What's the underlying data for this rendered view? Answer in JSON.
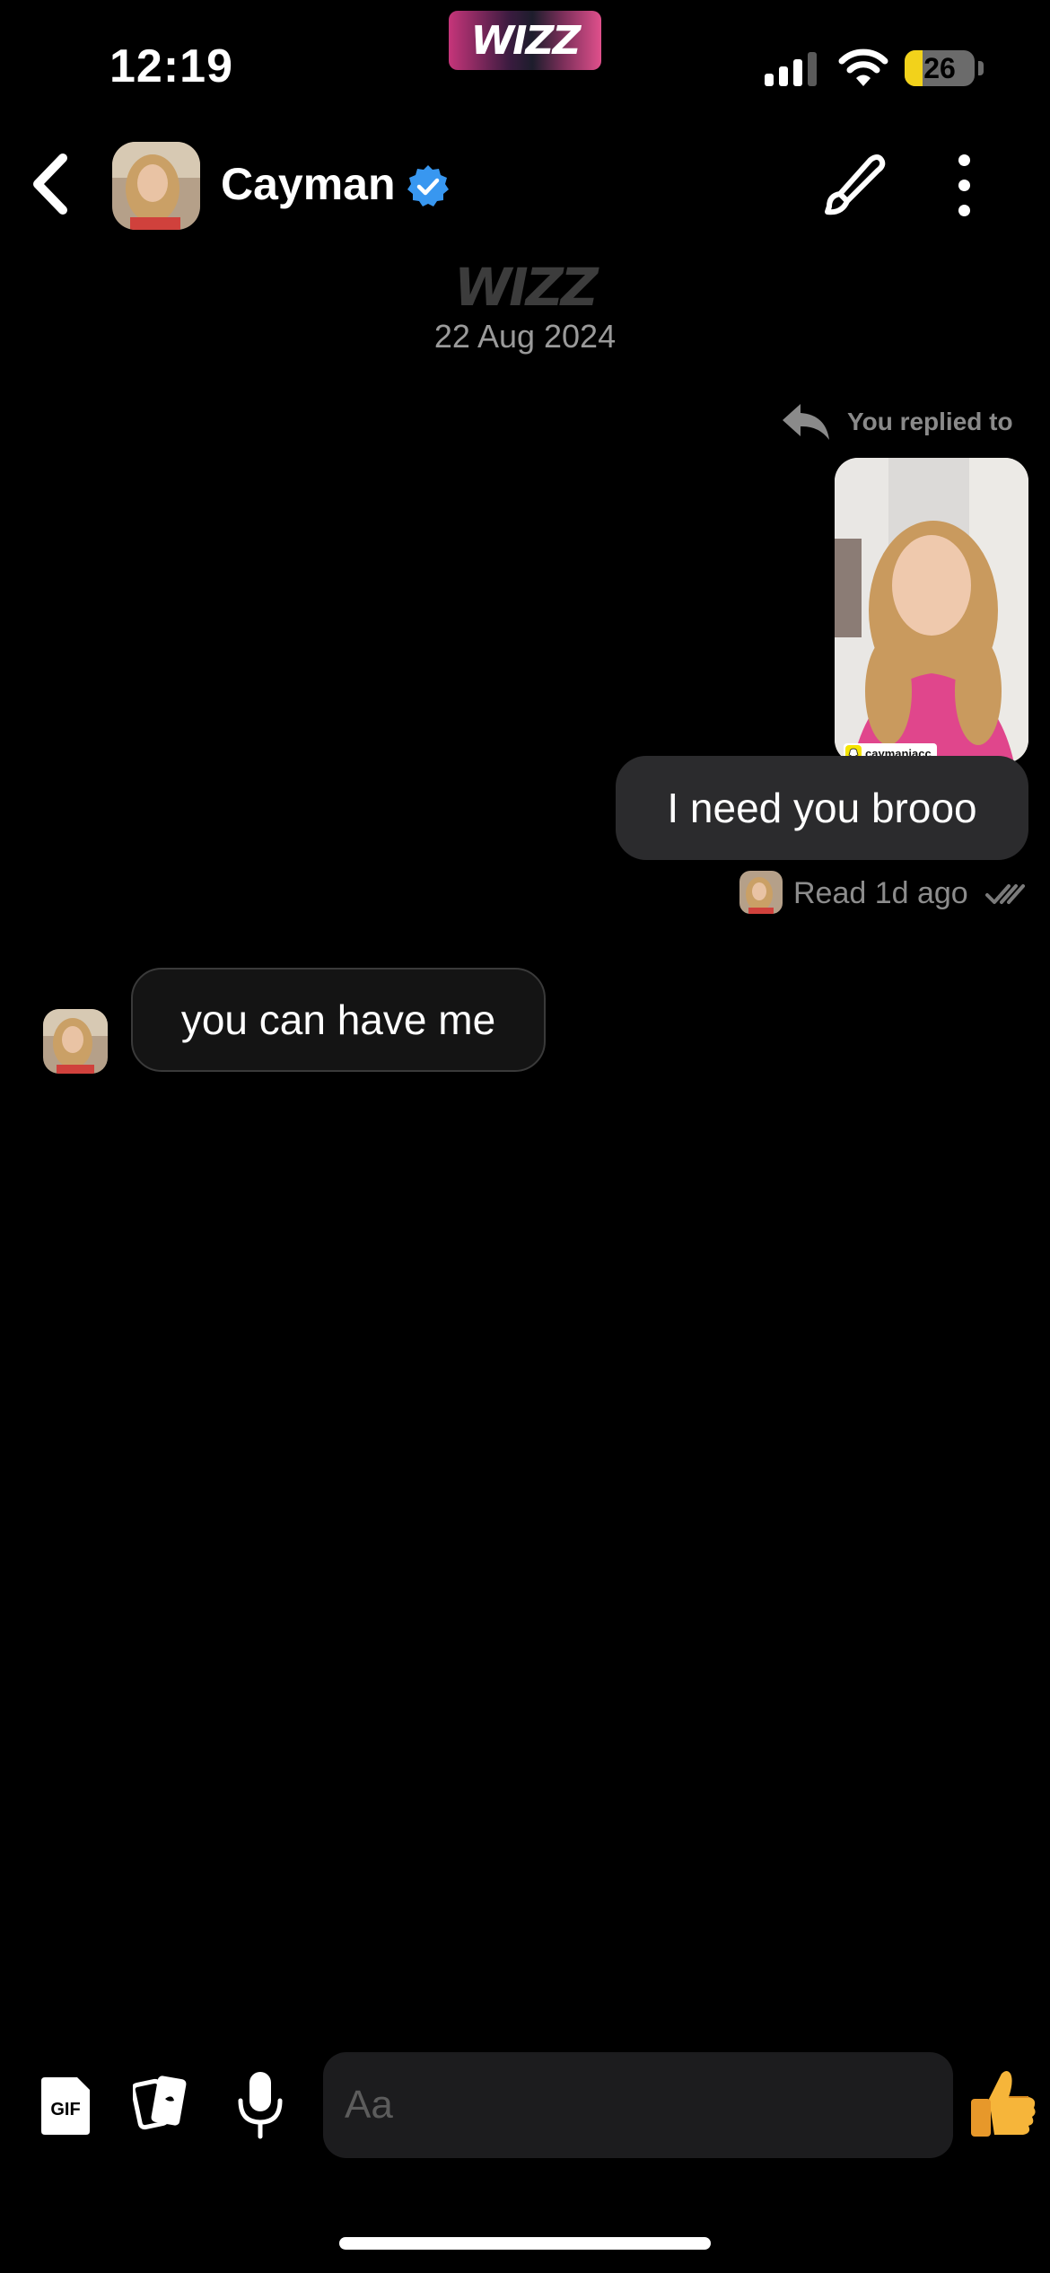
{
  "status_bar": {
    "time": "12:19",
    "app_pill_label": "WIZZ",
    "battery_level": "26",
    "battery_fraction": 0.26,
    "signal_bars_active": 3,
    "signal_bars_total": 4
  },
  "header": {
    "contact_name": "Cayman",
    "verified": true,
    "icons": {
      "back": "chevron-left-icon",
      "edit": "paintbrush-icon",
      "more": "more-vertical-icon"
    }
  },
  "thread": {
    "divider_logo": "WIZZ",
    "date": "22 Aug 2024",
    "reply_label": "You replied to",
    "story_tag": "caymaniacc",
    "messages": [
      {
        "direction": "out",
        "text": "I need you brooo"
      },
      {
        "direction": "in",
        "text": "you can have me"
      }
    ],
    "read_receipt": "Read 1d ago"
  },
  "composer": {
    "gif_label": "GIF",
    "placeholder": "Aa",
    "like_emoji": "👍"
  },
  "colors": {
    "background": "#000000",
    "bubble_out": "#2b2b2d",
    "bubble_in": "#141414",
    "verified": "#3897f0",
    "battery_fill": "#f2d21b"
  }
}
